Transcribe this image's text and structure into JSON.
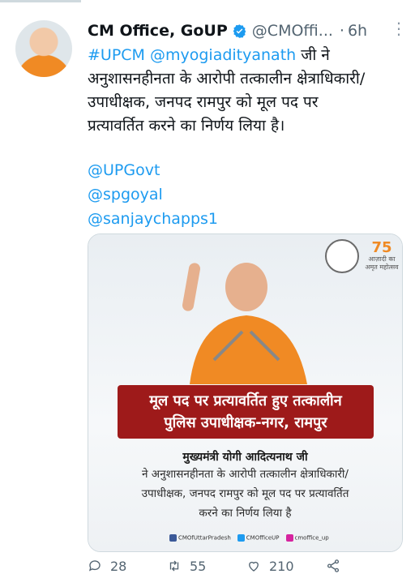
{
  "tweet": {
    "author_name": "CM Office, GoUP",
    "handle": "@CMOffi...",
    "separator": "·",
    "time": "6h",
    "more_label": "⋮",
    "text_line1_tags": "#UPCM @myogiadityanath",
    "text_line1_rest": " जी ने",
    "text_line2": "अनुशासनहीनता के आरोपी तत्कालीन क्षेत्राधिकारी/",
    "text_line3": "उपाधीक्षक, जनपद रामपुर को मूल पद पर",
    "text_line4": "प्रत्यावर्तित करने का निर्णय लिया है।",
    "mentions": [
      "@UPGovt",
      "@spgoyal",
      "@sanjaychapps1"
    ]
  },
  "media": {
    "banner_line1": "मूल पद पर प्रत्यावर्तित हुए तत्कालीन",
    "banner_line2": "पुलिस उपाधीक्षक-नगर, रामपुर",
    "caption_head": "मुख्यमंत्री योगी आदित्यनाथ जी",
    "caption_line1": "ने अनुशासनहीनता के आरोपी तत्कालीन क्षेत्राधिकारी/",
    "caption_line2": "उपाधीक्षक, जनपद रामपुर को मूल पद पर प्रत्यावर्तित",
    "caption_line3": "करने का निर्णय लिया है",
    "social_facebook": "CMOfUttarPradesh",
    "social_twitter": "CMOfficeUP",
    "social_instagram": "cmoffice_up",
    "azadi_number": "75",
    "azadi_text": "आज़ादी का अमृत महोत्सव"
  },
  "actions": {
    "replies": "28",
    "retweets": "55",
    "likes": "210"
  },
  "colors": {
    "link": "#1d9bf0",
    "banner": "#9e1a1a",
    "muted": "#536471"
  },
  "icons": [
    "verified-badge-icon",
    "more-icon",
    "reply-icon",
    "retweet-icon",
    "like-icon",
    "share-icon"
  ]
}
